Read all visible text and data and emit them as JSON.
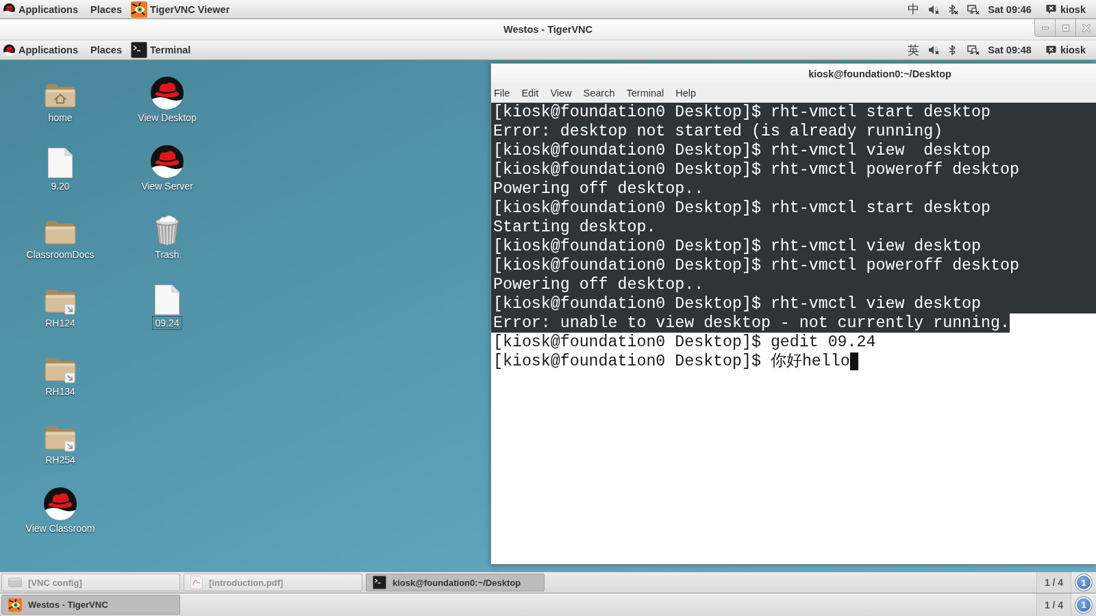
{
  "host_panel": {
    "menus": [
      "Applications",
      "Places"
    ],
    "window_button": {
      "kind": "vnc",
      "label": "TigerVNC Viewer"
    },
    "input_method": "中",
    "status_icons": [
      {
        "kind": "volume",
        "off": true
      },
      {
        "kind": "bluetooth",
        "off": true
      },
      {
        "kind": "network",
        "off": true
      }
    ],
    "clock": "Sat 09:46",
    "user": "kiosk"
  },
  "vnc_window": {
    "title": "Westos - TigerVNC"
  },
  "guest_panel": {
    "menus": [
      "Applications",
      "Places"
    ],
    "window_button": {
      "kind": "terminal",
      "label": "Terminal"
    },
    "input_method": "英",
    "status_icons": [
      {
        "kind": "volume",
        "off": true
      },
      {
        "kind": "bluetooth",
        "off": false
      },
      {
        "kind": "network",
        "off": true
      }
    ],
    "clock": "Sat 09:48",
    "user": "kiosk"
  },
  "desktop_icons": [
    {
      "kind": "home-folder",
      "label": "home",
      "focused": false
    },
    {
      "kind": "file",
      "label": "9.20",
      "focused": false
    },
    {
      "kind": "folder",
      "label": "ClassroomDocs",
      "focused": false
    },
    {
      "kind": "linked-folder",
      "label": "RH124",
      "focused": false
    },
    {
      "kind": "linked-folder",
      "label": "RH134",
      "focused": false
    },
    {
      "kind": "linked-folder",
      "label": "RH254",
      "focused": false
    },
    {
      "kind": "launcher",
      "label": "View Classroom",
      "focused": false
    },
    {
      "kind": "launcher",
      "label": "View Desktop",
      "focused": false
    },
    {
      "kind": "launcher",
      "label": "View Server",
      "focused": false
    },
    {
      "kind": "trash",
      "label": "Trash",
      "focused": false
    },
    {
      "kind": "file",
      "label": "09.24",
      "focused": true
    }
  ],
  "terminal": {
    "title": "kiosk@foundation0:~/Desktop",
    "menu": [
      "File",
      "Edit",
      "View",
      "Search",
      "Terminal",
      "Help"
    ],
    "lines": [
      {
        "text": "[kiosk@foundation0 Desktop]$ rht-vmctl start desktop",
        "selected": true,
        "cursor": false
      },
      {
        "text": "Error: desktop not started (is already running)",
        "selected": true,
        "cursor": false
      },
      {
        "text": "[kiosk@foundation0 Desktop]$ rht-vmctl view  desktop",
        "selected": true,
        "cursor": false
      },
      {
        "text": "[kiosk@foundation0 Desktop]$ rht-vmctl poweroff desktop",
        "selected": true,
        "cursor": false
      },
      {
        "text": "Powering off desktop..",
        "selected": true,
        "cursor": false
      },
      {
        "text": "[kiosk@foundation0 Desktop]$ rht-vmctl start desktop",
        "selected": true,
        "cursor": false
      },
      {
        "text": "Starting desktop.",
        "selected": true,
        "cursor": false
      },
      {
        "text": "[kiosk@foundation0 Desktop]$ rht-vmctl view desktop",
        "selected": true,
        "cursor": false
      },
      {
        "text": "[kiosk@foundation0 Desktop]$ rht-vmctl poweroff desktop",
        "selected": true,
        "cursor": false
      },
      {
        "text": "Powering off desktop..",
        "selected": true,
        "cursor": false
      },
      {
        "text": "[kiosk@foundation0 Desktop]$ rht-vmctl view desktop",
        "selected": true,
        "cursor": false
      },
      {
        "text": "Error: unable to view desktop - not currently running.",
        "selected": true,
        "cursor": false
      },
      {
        "text": "[kiosk@foundation0 Desktop]$ gedit 09.24",
        "selected": false,
        "cursor": false
      },
      {
        "text": "[kiosk@foundation0 Desktop]$ 你好hello",
        "selected": false,
        "cursor": true
      }
    ]
  },
  "guest_taskbar": {
    "tasks": [
      {
        "kind": "config",
        "label": "[VNC config]",
        "minimized": true,
        "selected": false
      },
      {
        "kind": "pdf",
        "label": "[introduction.pdf]",
        "minimized": true,
        "selected": false
      },
      {
        "kind": "terminal",
        "label": "kiosk@foundation0:~/Desktop",
        "minimized": false,
        "selected": true
      }
    ],
    "workspace": "1 / 4",
    "notifications": "1"
  },
  "host_taskbar": {
    "tasks": [
      {
        "kind": "vnc",
        "label": "Westos - TigerVNC",
        "minimized": false,
        "selected": true
      }
    ],
    "workspace": "1 / 4",
    "notifications": "1"
  }
}
